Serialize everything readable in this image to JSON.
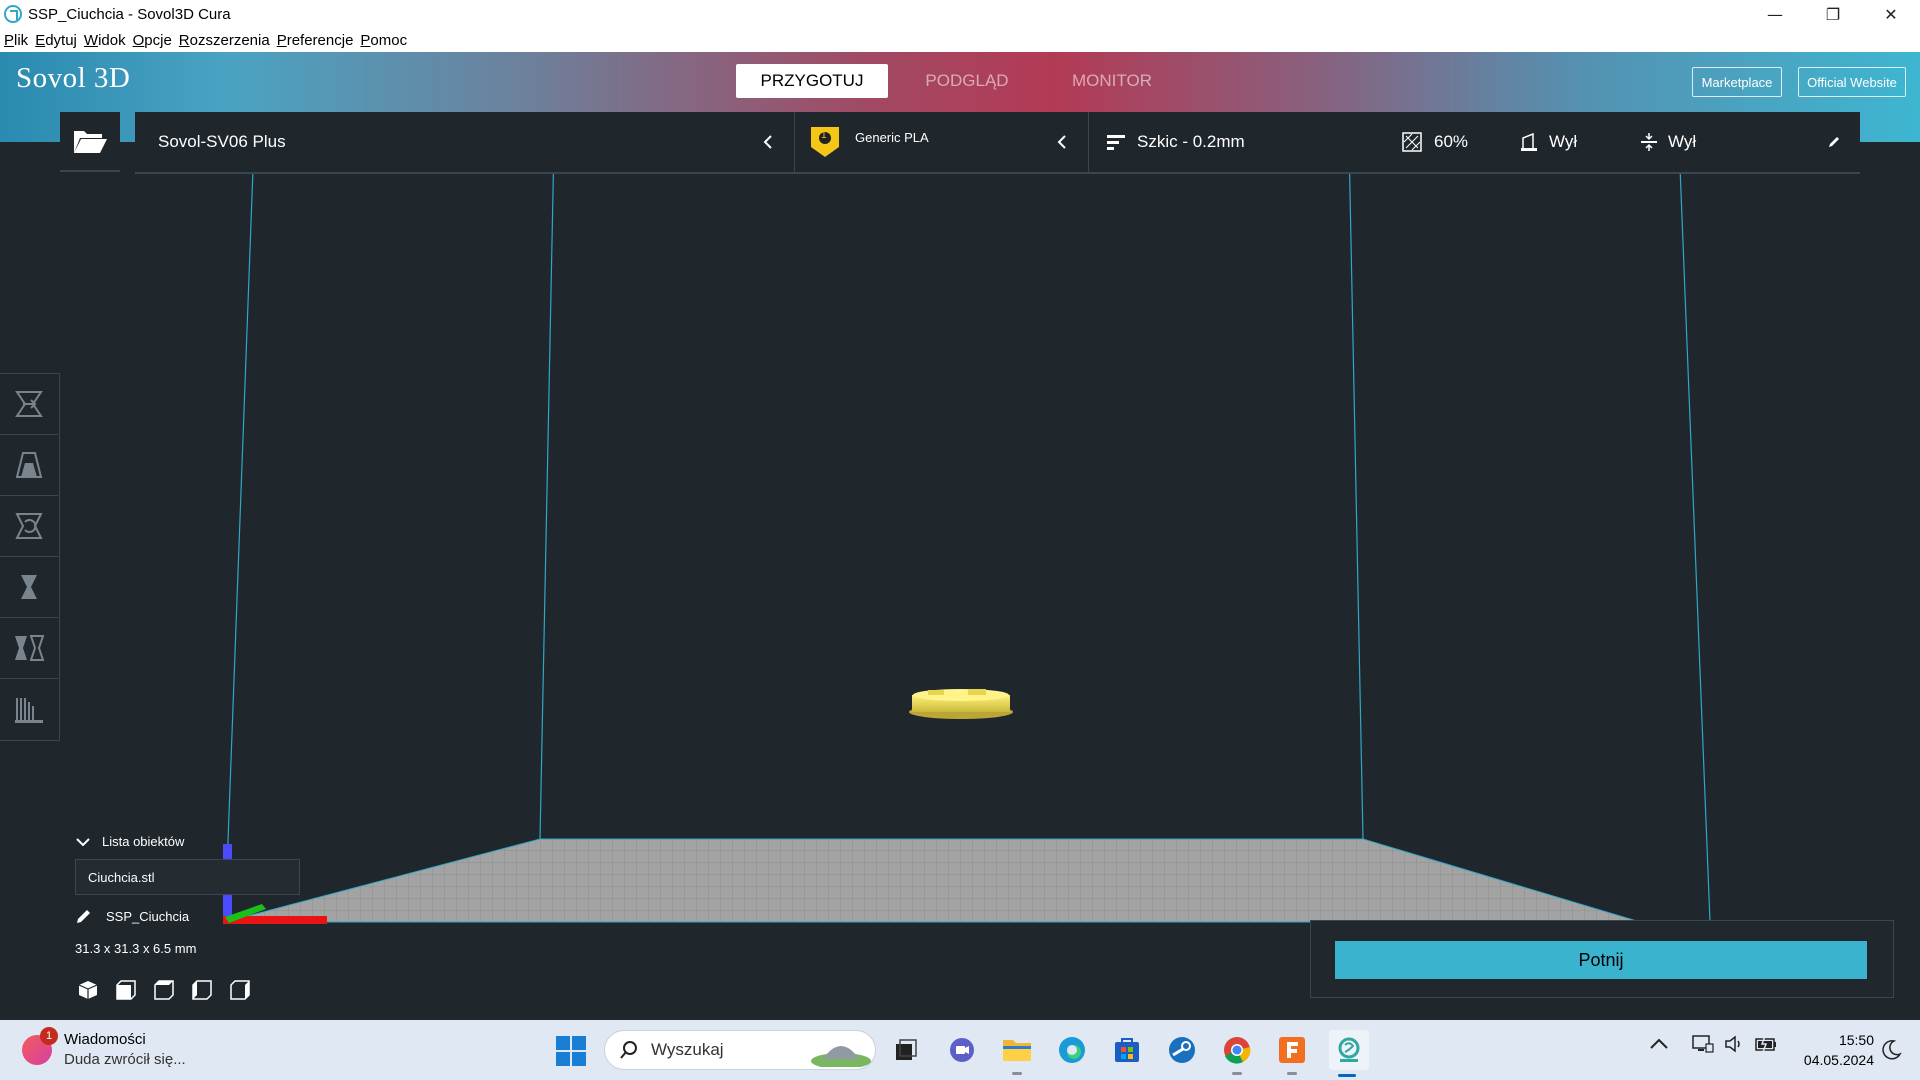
{
  "window": {
    "title": "SSP_Ciuchcia - Sovol3D Cura",
    "controls": {
      "minimize": "—",
      "restore": "❐",
      "close": "✕"
    }
  },
  "menubar": {
    "items": [
      "Plik",
      "Edytuj",
      "Widok",
      "Opcje",
      "Rozszerzenia",
      "Preferencje",
      "Pomoc"
    ]
  },
  "header": {
    "brand": "Sovol 3D",
    "tabs": [
      {
        "label": "PRZYGOTUJ",
        "active": true
      },
      {
        "label": "PODGLĄD",
        "active": false
      },
      {
        "label": "MONITOR",
        "active": false
      }
    ],
    "marketplace": "Marketplace",
    "official_website": "Official Website"
  },
  "toolbar": {
    "printer": "Sovol-SV06 Plus",
    "extruder_number": "1",
    "material": "Generic PLA",
    "profile": "Szkic - 0.2mm",
    "infill": "60%",
    "support": "Wył",
    "adhesion": "Wył"
  },
  "tools": [
    "move-tool",
    "scale-tool",
    "rotate-tool",
    "mirror-tool",
    "per-model-settings-tool",
    "support-blocker-tool"
  ],
  "object_list": {
    "header": "Lista obiektów",
    "items": [
      "Ciuchcia.stl"
    ],
    "current_object": "SSP_Ciuchcia",
    "dimensions": "31.3 x 31.3 x 6.5 mm"
  },
  "view_buttons": [
    "3d-view",
    "front-view",
    "top-view",
    "left-view",
    "right-view"
  ],
  "slice": {
    "button_label": "Potnij"
  },
  "taskbar": {
    "widget_title": "Wiadomości",
    "widget_subtitle": "Duda zwrócił się...",
    "widget_badge": "1",
    "search_placeholder": "Wyszukaj",
    "time": "15:50",
    "date": "04.05.2024"
  },
  "colors": {
    "accent": "#3ab3cf",
    "background": "#1f262c",
    "build_volume_lines": "#2fa8c6",
    "model": "#f2e157",
    "plate": "#9a9a9a"
  }
}
